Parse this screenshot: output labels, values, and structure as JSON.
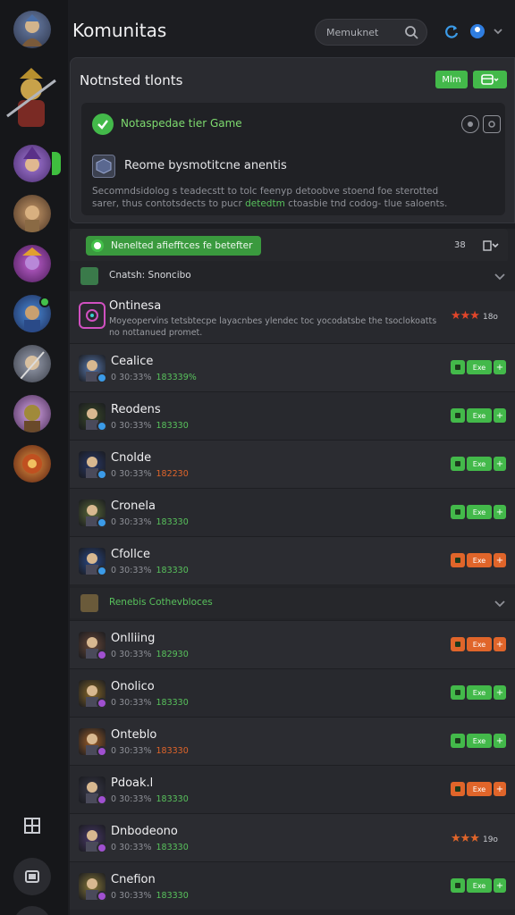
{
  "colors": {
    "accent_green": "#43b94a",
    "accent_orange": "#e0652a",
    "panel": "#2a2b30",
    "bg": "#1c1d21"
  },
  "header": {
    "title": "Komunitas",
    "search_placeholder": "Memuknet"
  },
  "notice": {
    "title": "Notnsted tlonts",
    "button_label": "Mlm",
    "game_line": "Notaspedae tier Game",
    "friend_line": "Reome bysmotitcne anentis",
    "desc_part1": "Secomndsidolog s teadecstt to tolc feenyp detoobve stoend foe sterotted sarer, thus contotsdects to pucr ",
    "desc_highlight": "detedtm",
    "desc_part2": " ctoasbie tnd codog- tlue saloents."
  },
  "list": {
    "banner_label": "Nenelted afiefftces fe betefter",
    "right_count": "38",
    "section1_title": "Cnatsh: Snoncibo",
    "section2_title": "Renebis Cothevbloces",
    "featured": {
      "name": "Ontinesa",
      "desc": "Moyeopervins tetsbtecpe layacnbes ylendec toc yocodatsbe the tsoclokoatts no nottanued promet.",
      "rating_count": "18o"
    },
    "rows": [
      {
        "name": "Cealice",
        "stat_prefix": "0 30:33%",
        "stat_value": "183339%",
        "stat_color": "green",
        "action": "green",
        "action_label": "Exe"
      },
      {
        "name": "Reodens",
        "stat_prefix": "0 30:33%",
        "stat_value": "183330",
        "stat_color": "green",
        "action": "green",
        "action_label": "Exe"
      },
      {
        "name": "Cnolde",
        "stat_prefix": "0 30:33%",
        "stat_value": "182230",
        "stat_color": "orange",
        "action": "green",
        "action_label": "Exe"
      },
      {
        "name": "Cronela",
        "stat_prefix": "0 30:33%",
        "stat_value": "183330",
        "stat_color": "green",
        "action": "green",
        "action_label": "Exe"
      },
      {
        "name": "Cfollce",
        "stat_prefix": "0 30:33%",
        "stat_value": "183330",
        "stat_color": "green",
        "action": "orange",
        "action_label": "Exe"
      }
    ],
    "rows2": [
      {
        "name": "Onlliing",
        "stat_prefix": "0 30:33%",
        "stat_value": "182930",
        "stat_color": "green",
        "action": "orange",
        "action_label": "Exe"
      },
      {
        "name": "Onolico",
        "stat_prefix": "0 30:33%",
        "stat_value": "183330",
        "stat_color": "green",
        "action": "green",
        "action_label": "Exe"
      },
      {
        "name": "Onteblo",
        "stat_prefix": "0 30:33%",
        "stat_value": "183330",
        "stat_color": "orange",
        "action": "green",
        "action_label": "Exe"
      },
      {
        "name": "Pdoak.l",
        "stat_prefix": "0 30:33%",
        "stat_value": "183330",
        "stat_color": "green",
        "action": "orange",
        "action_label": "Exe"
      },
      {
        "name": "Dnbodeono",
        "stat_prefix": "0 30:33%",
        "stat_value": "183330",
        "stat_color": "green",
        "action": "stars",
        "action_label": "19o"
      },
      {
        "name": "Cnefion",
        "stat_prefix": "0 30:33%",
        "stat_value": "183330",
        "stat_color": "green",
        "action": "green",
        "action_label": "Exe"
      }
    ]
  },
  "rail": {
    "icons": [
      "grid-icon",
      "window-icon"
    ]
  }
}
